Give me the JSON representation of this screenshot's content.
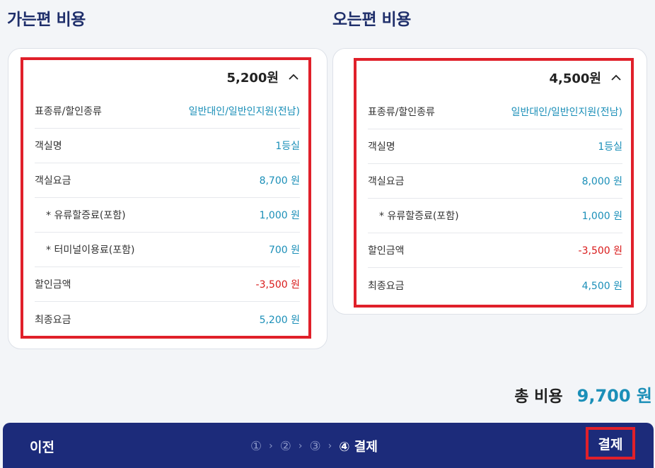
{
  "outbound": {
    "title": "가는편 비용",
    "amount": "5,200원",
    "rows": [
      {
        "label": "표종류/할인종류",
        "value": "일반대인/일반인지원(전남)"
      },
      {
        "label": "객실명",
        "value": "1등실"
      },
      {
        "label": "객실요금",
        "value": "8,700 원"
      },
      {
        "label": "* 유류할증료(포함)",
        "value": "1,000 원"
      },
      {
        "label": "* 터미널이용료(포함)",
        "value": "700 원"
      },
      {
        "label": "할인금액",
        "value": "-3,500 원"
      },
      {
        "label": "최종요금",
        "value": "5,200 원"
      }
    ]
  },
  "inbound": {
    "title": "오는편 비용",
    "amount": "4,500원",
    "rows": [
      {
        "label": "표종류/할인종류",
        "value": "일반대인/일반인지원(전남)"
      },
      {
        "label": "객실명",
        "value": "1등실"
      },
      {
        "label": "객실요금",
        "value": "8,000 원"
      },
      {
        "label": "* 유류할증료(포함)",
        "value": "1,000 원"
      },
      {
        "label": "할인금액",
        "value": "-3,500 원"
      },
      {
        "label": "최종요금",
        "value": "4,500 원"
      }
    ]
  },
  "total": {
    "label": "총 비용",
    "value": "9,700 원"
  },
  "nav": {
    "prev_label": "이전",
    "steps": [
      "①",
      "②",
      "③",
      "④ 결제"
    ],
    "pay_label": "결제"
  },
  "colors": {
    "accent": "#1b8fb8",
    "navy": "#1c2b7a",
    "negative": "#d91a1a",
    "highlight": "#e0202a"
  }
}
